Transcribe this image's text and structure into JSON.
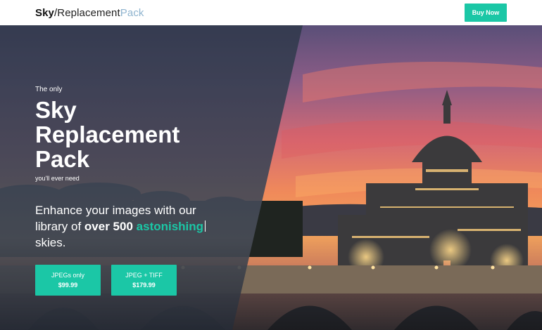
{
  "header": {
    "logo": {
      "sky": "Sky",
      "slash": "/",
      "replacement": "Replacement",
      "pack": "Pack"
    },
    "buy_label": "Buy Now"
  },
  "hero": {
    "eyebrow": "The only",
    "headline": [
      "Sky",
      "Replacement",
      "Pack"
    ],
    "tagline": "you'll ever need",
    "lead": {
      "prefix": "Enhance your images with our library of ",
      "bold": "over 500",
      "accent": "astonishing",
      "suffix": "skies."
    },
    "buttons": [
      {
        "name": "JPEGs only",
        "price": "$99.99"
      },
      {
        "name": "JPEG + TIFF",
        "price": "$179.99"
      }
    ]
  },
  "colors": {
    "accent": "#1bc7a6",
    "logo_pack": "#8fb4cf",
    "header_bg": "#ffffff"
  }
}
